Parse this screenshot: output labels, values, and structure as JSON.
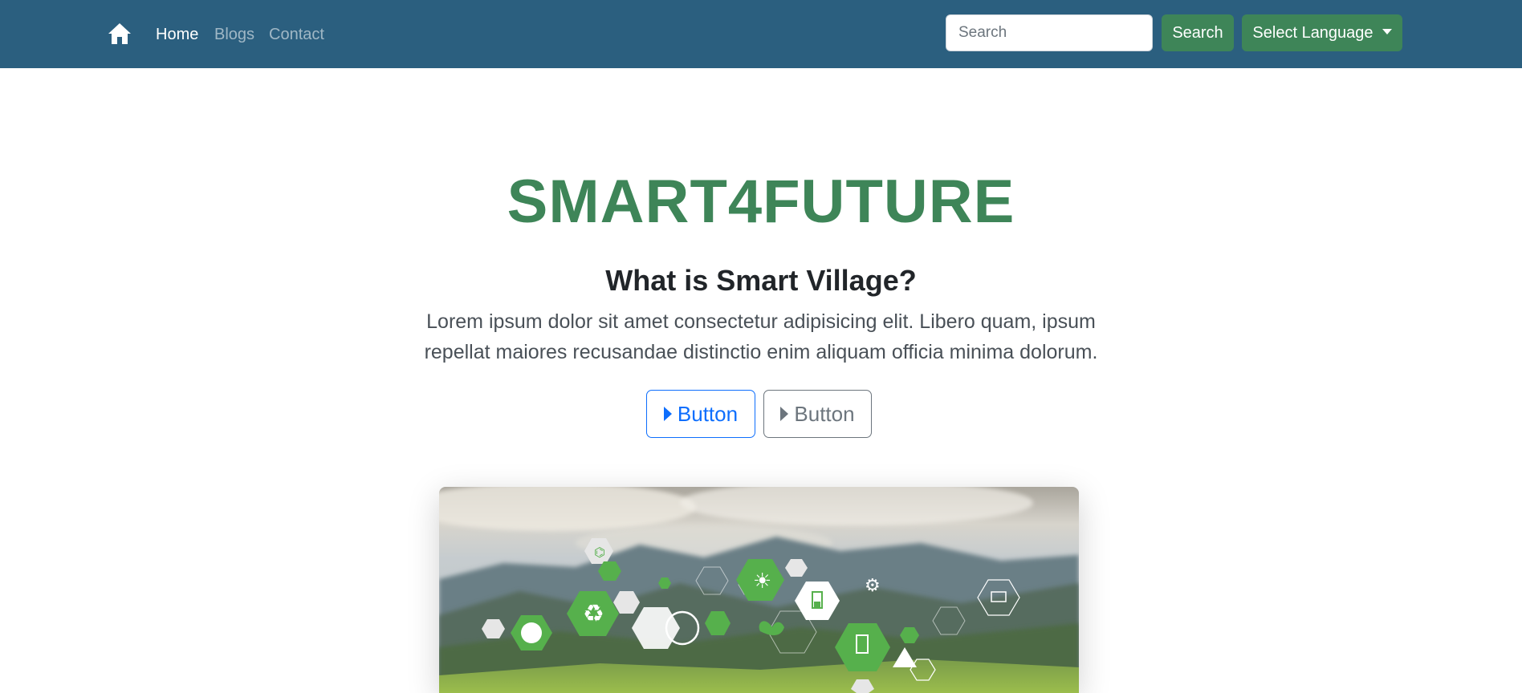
{
  "navbar": {
    "links": [
      {
        "label": "Home",
        "active": true
      },
      {
        "label": "Blogs",
        "active": false
      },
      {
        "label": "Contact",
        "active": false
      }
    ],
    "search": {
      "placeholder": "Search",
      "value": ""
    },
    "search_button": "Search",
    "language_button": "Select Language",
    "icon": "home-icon"
  },
  "hero": {
    "title": "SMART4FUTURE",
    "subtitle": "What is Smart Village?",
    "lead": "Lorem ipsum dolor sit amet consectetur adipisicing elit. Libero quam, ipsum repellat maiores recusandae distinctio enim aliquam officia minima dolorum.",
    "buttons": [
      {
        "label": "Button",
        "style": "primary"
      },
      {
        "label": "Button",
        "style": "secondary"
      }
    ]
  },
  "colors": {
    "navbar": "#2b5f7f",
    "brand_green": "#3e8558",
    "primary_blue": "#0d6efd",
    "secondary_gray": "#6c757d",
    "icon_green": "#56b04c"
  }
}
